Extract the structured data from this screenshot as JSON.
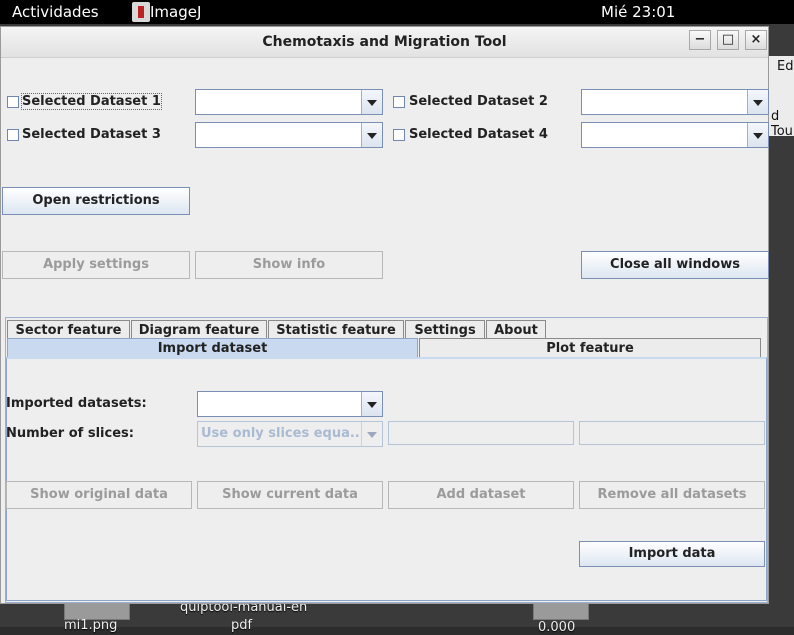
{
  "topbar": {
    "activities": "Actividades",
    "app_name": "ImageJ",
    "clock": "Mié 23:01"
  },
  "background_window": {
    "menu_fragment": "Edi",
    "text_fragment": "d Tou"
  },
  "desktop": {
    "icon_label_1": "mi1.png",
    "icon_label_2": "quiptool-manual-en",
    "icon_label_2b": "pdf",
    "icon_label_3": "0.000"
  },
  "window": {
    "title": "Chemotaxis and Migration Tool",
    "controls": {
      "minimize": "−",
      "maximize": "□",
      "close": "×"
    }
  },
  "datasets": [
    {
      "label": "Selected Dataset 1",
      "checked": false,
      "value": ""
    },
    {
      "label": "Selected Dataset 2",
      "checked": false,
      "value": ""
    },
    {
      "label": "Selected Dataset 3",
      "checked": false,
      "value": ""
    },
    {
      "label": "Selected Dataset 4",
      "checked": false,
      "value": ""
    }
  ],
  "buttons": {
    "open_restrictions": "Open restrictions",
    "apply_settings": "Apply settings",
    "show_info": "Show info",
    "close_all_windows": "Close all windows"
  },
  "tabs_row1": [
    "Sector feature",
    "Diagram feature",
    "Statistic feature",
    "Settings",
    "About"
  ],
  "tabs_row2": [
    "Import dataset",
    "Plot feature"
  ],
  "selected_tab": "Import dataset",
  "import": {
    "imported_datasets_label": "Imported datasets:",
    "imported_datasets_value": "",
    "slices_label": "Number of slices:",
    "slices_value": "Use only slices equa...",
    "show_original": "Show original data",
    "show_current": "Show current data",
    "add_dataset": "Add dataset",
    "remove_all": "Remove all datasets",
    "import_data": "Import data"
  },
  "colors": {
    "tab_selected": "#c9daf0",
    "border_accent": "#7a8fb4",
    "window_bg": "#eeeeee"
  }
}
